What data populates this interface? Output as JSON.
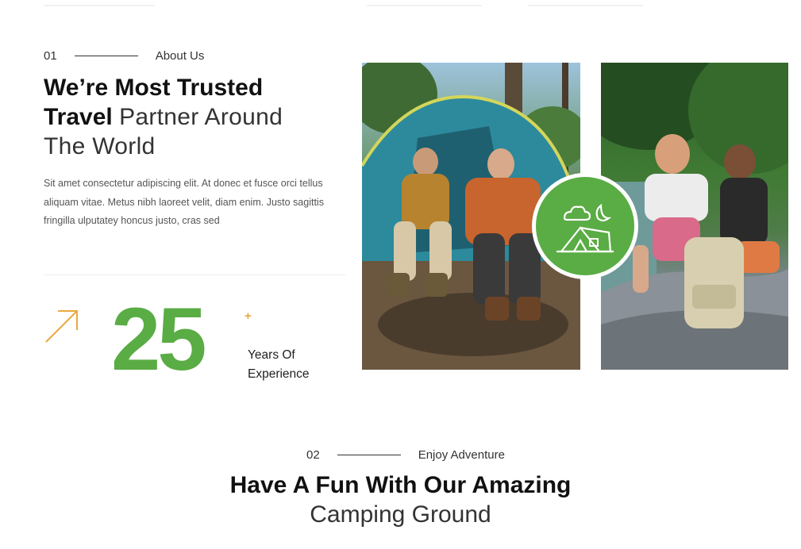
{
  "about": {
    "number": "01",
    "label": "About Us",
    "heading_bold_1": "We’re Most Trusted",
    "heading_bold_2": "Travel",
    "heading_light_2": "Partner Around",
    "heading_light_3": "The World",
    "paragraph": "Sit amet consectetur adipiscing elit. At donec et fusce orci tellus aliquam vitae. Metus nibh laoreet velit, diam enim. Justo sagittis fringilla ulputatey honcus justo, cras sed"
  },
  "stats": {
    "number": "25",
    "plus": "+",
    "label_line1": "Years Of",
    "label_line2": "Experience",
    "icon": "arrow-up-right-icon"
  },
  "badge": {
    "icon": "camping-tent-icon"
  },
  "enjoy": {
    "number": "02",
    "label": "Enjoy Adventure",
    "heading_bold": "Have A Fun With Our Amazing",
    "heading_light": "Camping Ground"
  },
  "colors": {
    "accent_green": "#5aac44",
    "accent_orange": "#e8a940"
  }
}
